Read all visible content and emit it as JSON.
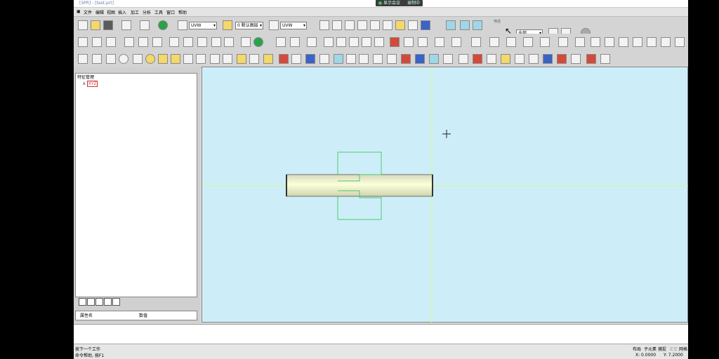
{
  "window": {
    "title": "[SPR] - [test.prt]"
  },
  "recording": {
    "label": "显示会议",
    "label2": "录制中"
  },
  "menu": [
    "文件",
    "编辑",
    "视图",
    "插入",
    "加工",
    "分析",
    "工具",
    "窗口",
    "帮助"
  ],
  "toolbar": {
    "view_dd": "UVW",
    "layer_dd": "0 默认图层",
    "coord_dd": "UVW",
    "filter_dd": "全部",
    "filter_label": "筛选"
  },
  "tree": {
    "header": "特征管理",
    "root": "XYZ"
  },
  "props": {
    "col1": "属性名",
    "col2": "数值"
  },
  "command": {
    "prompt": ""
  },
  "status": {
    "line1": "按下一个工作",
    "line2": "命令帮助, 按F1",
    "mode1": "布局",
    "mode2": "子元素",
    "mode3": "捕捉",
    "mode4": "正交",
    "mode5": "网格",
    "x": "X: 0.0000",
    "y": "Y: 7.2000"
  },
  "colors": {
    "viewport_bg": "#cdeef9",
    "shaft": "#f7fbd0",
    "outline": "#4fc86a",
    "axis": "#d8f57a"
  }
}
